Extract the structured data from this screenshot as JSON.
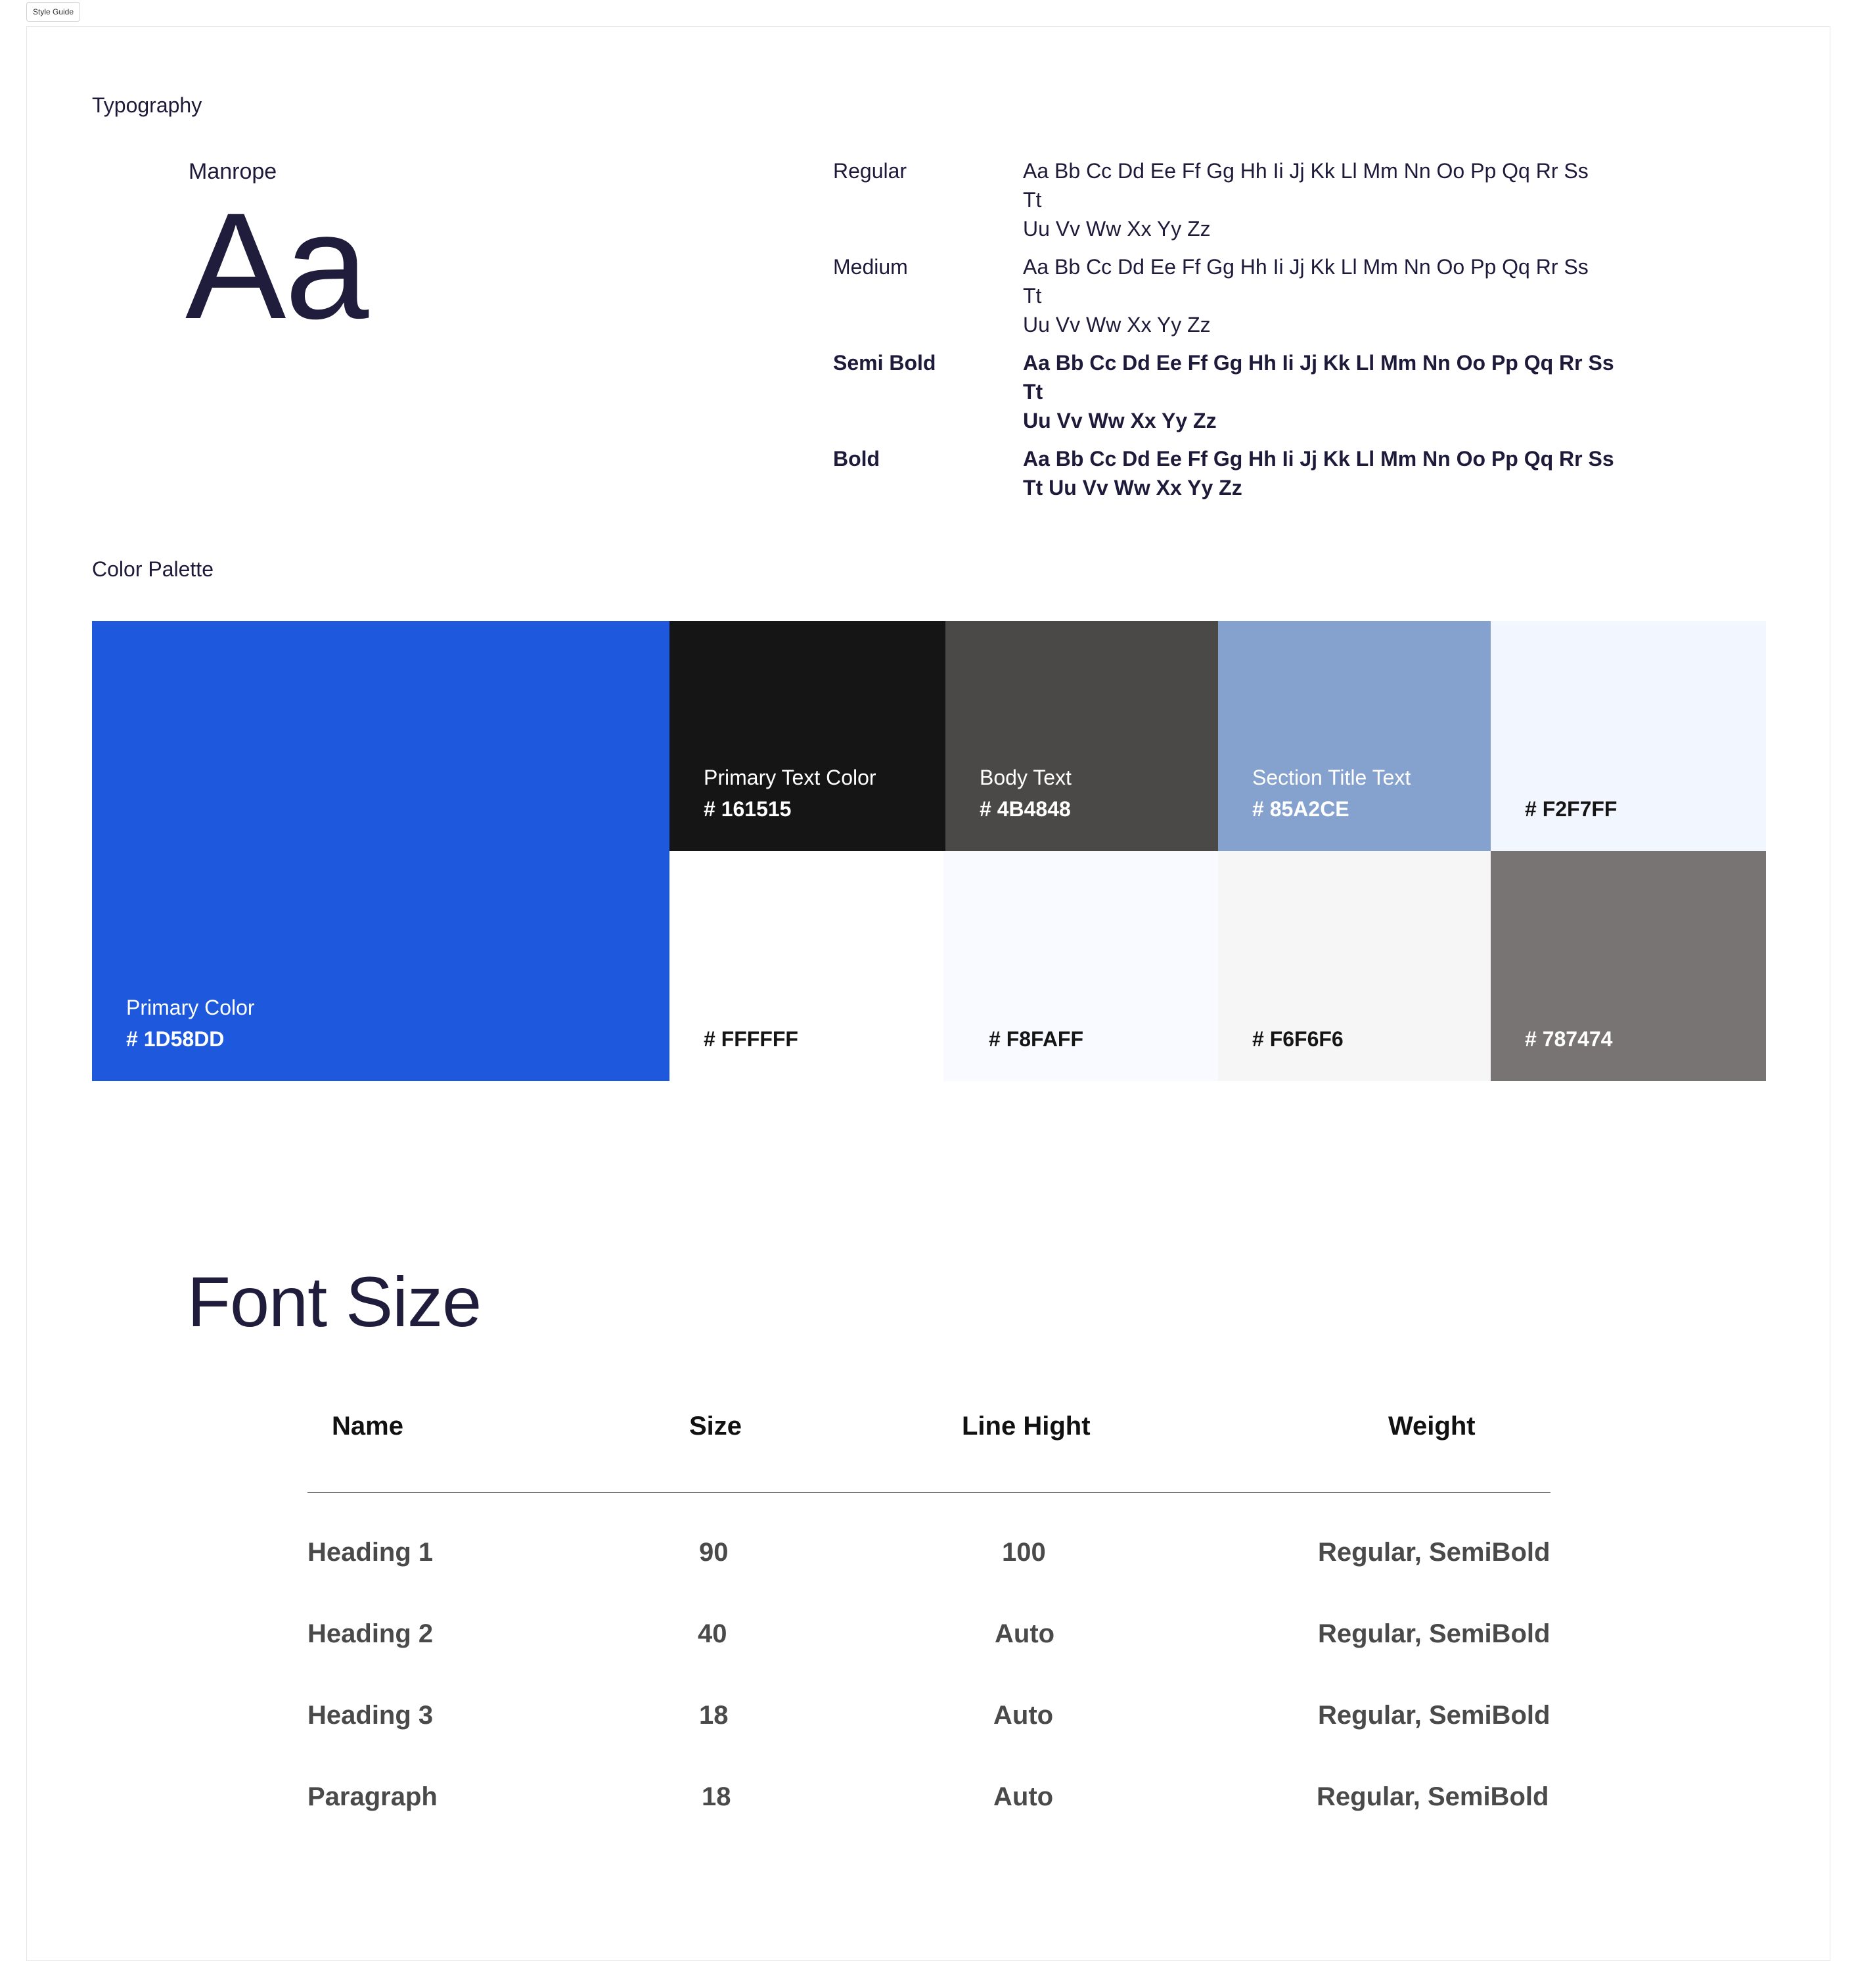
{
  "frame": {
    "label": "Style Guide"
  },
  "typography": {
    "section_title": "Typography",
    "font_name": "Manrope",
    "sample": "Aa",
    "weights": [
      {
        "label": "Regular",
        "line1": "Aa Bb Cc Dd Ee Ff Gg Hh Ii Jj Kk Ll Mm Nn Oo Pp Qq Rr Ss Tt",
        "line2": "Uu Vv Ww Xx Yy Zz"
      },
      {
        "label": "Medium",
        "line1": "Aa Bb Cc Dd Ee Ff Gg Hh Ii Jj Kk Ll Mm Nn Oo Pp Qq Rr Ss Tt",
        "line2": "Uu Vv Ww Xx Yy Zz"
      },
      {
        "label": "Semi Bold",
        "line1": "Aa Bb Cc Dd Ee Ff Gg Hh Ii Jj Kk Ll Mm Nn Oo Pp Qq Rr Ss Tt",
        "line2": "Uu Vv Ww Xx Yy Zz"
      },
      {
        "label": "Bold",
        "line1": "Aa Bb Cc Dd Ee Ff Gg Hh Ii Jj Kk Ll Mm Nn Oo Pp Qq Rr Ss",
        "line2": "Tt Uu Vv Ww Xx Yy Zz"
      }
    ]
  },
  "palette": {
    "section_title": "Color Palette",
    "swatches": [
      {
        "name": "Primary Color",
        "hex_label": "# 1D58DD",
        "color": "#1D58DD",
        "text_color": "#ffffff"
      },
      {
        "name": "Primary Text Color",
        "hex_label": "# 161515",
        "color": "#161515",
        "text_color": "#ffffff"
      },
      {
        "name": "Body Text",
        "hex_label": "# 4B4848",
        "color": "#4B4848",
        "text_color": "#ffffff"
      },
      {
        "name": "Section Title Text",
        "hex_label": "# 85A2CE",
        "color": "#85A2CE",
        "text_color": "#ffffff"
      },
      {
        "name": "",
        "hex_label": "# F2F7FF",
        "color": "#F2F7FF",
        "text_color": "#161515"
      },
      {
        "name": "",
        "hex_label": "# FFFFFF",
        "color": "#FFFFFF",
        "text_color": "#161515"
      },
      {
        "name": "",
        "hex_label": "# F8FAFF",
        "color": "#F8FAFF",
        "text_color": "#161515"
      },
      {
        "name": "",
        "hex_label": "# F6F6F6",
        "color": "#F6F6F6",
        "text_color": "#161515"
      },
      {
        "name": "",
        "hex_label": "# 787474",
        "color": "#787474",
        "text_color": "#ffffff"
      }
    ]
  },
  "font_size": {
    "title": "Font Size",
    "headers": {
      "name": "Name",
      "size": "Size",
      "line_height": "Line Hight",
      "weight": "Weight"
    },
    "rows": [
      {
        "name": "Heading 1",
        "size": "90",
        "line_height": "100",
        "weight": "Regular, SemiBold"
      },
      {
        "name": "Heading 2",
        "size": "40",
        "line_height": "Auto",
        "weight": "Regular, SemiBold"
      },
      {
        "name": "Heading 3",
        "size": "18",
        "line_height": "Auto",
        "weight": "Regular, SemiBold"
      },
      {
        "name": "Paragraph",
        "size": "18",
        "line_height": "Auto",
        "weight": "Regular, SemiBold"
      }
    ]
  }
}
